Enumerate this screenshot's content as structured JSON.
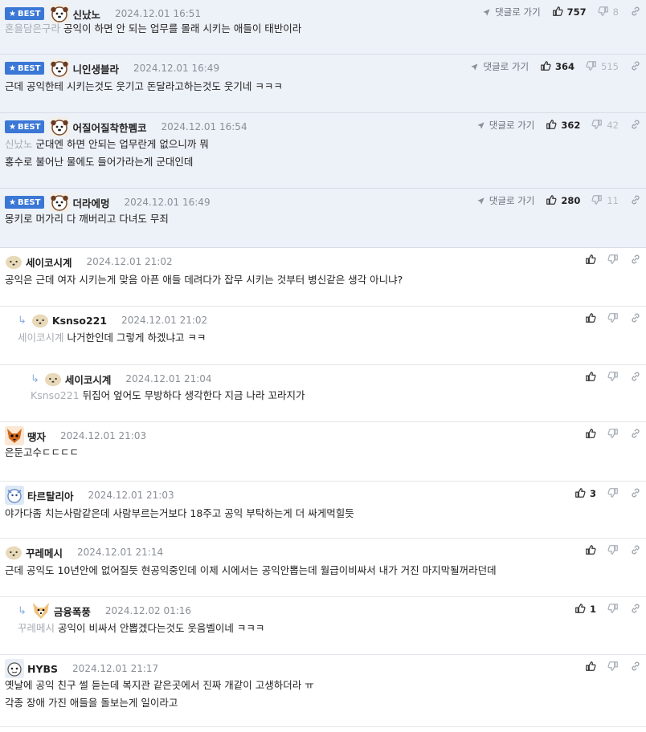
{
  "best_label": "BEST",
  "goto_label": "댓글로 가기",
  "comments": [
    {
      "nick": "신났노",
      "time": "2024.12.01 16:51",
      "up": "757",
      "down": "8",
      "mention": "혼을담은구라",
      "lines": [
        "공익이 하면 안 되는 업무를 몰래 시키는 애들이 태반이라"
      ]
    },
    {
      "nick": "니인생블라",
      "time": "2024.12.01 16:49",
      "up": "364",
      "down": "515",
      "mention": "",
      "lines": [
        "근데 공익한테 시키는것도 웃기고 돈달라고하는것도 웃기네 ㅋㅋㅋ"
      ]
    },
    {
      "nick": "어질어질착한펨코",
      "time": "2024.12.01 16:54",
      "up": "362",
      "down": "42",
      "mention": "신났노",
      "lines": [
        "군대엔 하면 안되는 업무란게 없으니까 뭐",
        "홍수로 불어난 물에도 들어가라는게 군대인데"
      ]
    },
    {
      "nick": "더라에멍",
      "time": "2024.12.01 16:49",
      "up": "280",
      "down": "11",
      "mention": "",
      "lines": [
        "몽키로 머가리 다 깨버리고 다녀도 무죄"
      ]
    },
    {
      "nick": "세이코시계",
      "time": "2024.12.01 21:02",
      "up": "",
      "mention": "",
      "lines": [
        "공익은 근데 여자 시키는게 맞음 아픈 애들 데려다가 잡무 시키는 것부터 병신같은 생각 아니냐?"
      ]
    },
    {
      "nick": "Ksnso221",
      "time": "2024.12.01 21:02",
      "up": "",
      "mention": "세이코시계",
      "lines": [
        "나거한인데 그렇게 하겠냐고 ㅋㅋ"
      ]
    },
    {
      "nick": "세이코시계",
      "time": "2024.12.01 21:04",
      "up": "",
      "mention": "Ksnso221",
      "lines": [
        "뒤집어 엎어도 무방하다 생각한다 지금 나라 꼬라지가"
      ]
    },
    {
      "nick": "땡자",
      "time": "2024.12.01 21:03",
      "up": "",
      "mention": "",
      "lines": [
        "은둔고수ㄷㄷㄷㄷ"
      ]
    },
    {
      "nick": "타르탈리아",
      "time": "2024.12.01 21:03",
      "up": "3",
      "mention": "",
      "lines": [
        "야가다좀 치는사람같은데 사람부르는거보다 18주고 공익 부탁하는게 더 싸게먹힐듯"
      ]
    },
    {
      "nick": "꾸레메시",
      "time": "2024.12.01 21:14",
      "up": "",
      "mention": "",
      "lines": [
        "근데 공익도 10년안에 없어질듯 현공익중인데 이제 시에서는 공익안뽑는데 월급이비싸서 내가 거진 마지막될꺼라던데"
      ]
    },
    {
      "nick": "금융폭풍",
      "time": "2024.12.02 01:16",
      "up": "1",
      "mention": "꾸레메시",
      "lines": [
        "공익이 비싸서 안뽑겠다는것도 웃음벨이네 ㅋㅋㅋ"
      ]
    },
    {
      "nick": "HYBS",
      "time": "2024.12.01 21:17",
      "up": "",
      "mention": "",
      "lines": [
        "옛날에 공익 친구 썰 듣는데 복지관 같은곳에서 진짜 개같이 고생하더라 ㅠ",
        "각종 장애 가진 애들을 돌보는게 일이라고"
      ]
    }
  ]
}
